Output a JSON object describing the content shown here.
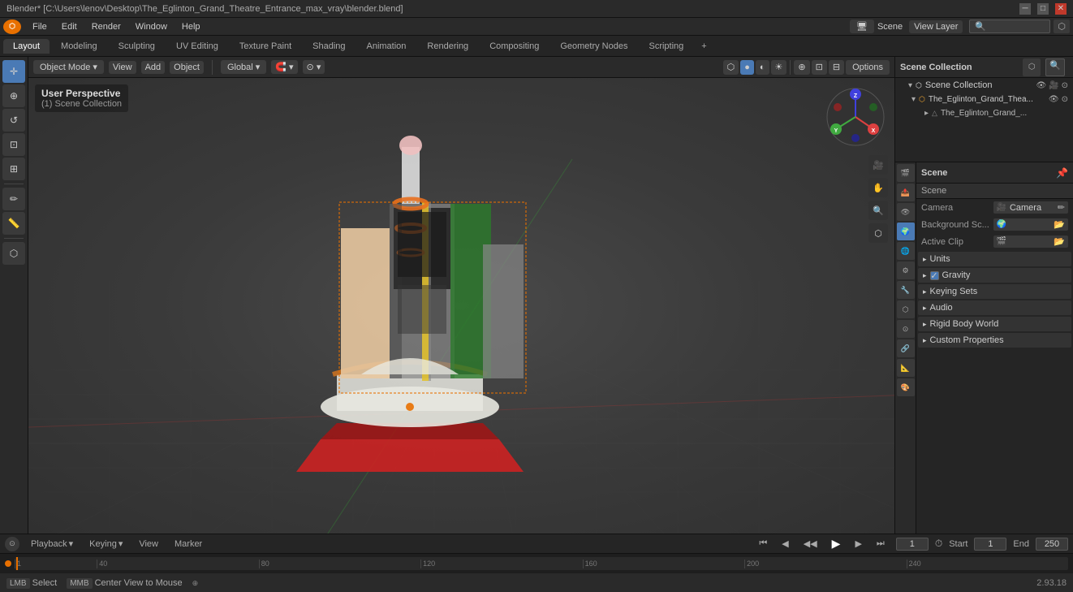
{
  "window": {
    "title": "Blender* [C:\\Users\\lenov\\Desktop\\The_Eglinton_Grand_Theatre_Entrance_max_vray\\blender.blend]",
    "controls": [
      "_",
      "□",
      "✕"
    ]
  },
  "menubar": {
    "items": [
      "Blender",
      "File",
      "Edit",
      "Render",
      "Window",
      "Help"
    ]
  },
  "workspace_tabs": {
    "tabs": [
      "Layout",
      "Modeling",
      "Sculpting",
      "UV Editing",
      "Texture Paint",
      "Shading",
      "Animation",
      "Rendering",
      "Compositing",
      "Geometry Nodes",
      "Scripting"
    ],
    "active": "Layout",
    "add_label": "+"
  },
  "viewport": {
    "mode": "Object Mode",
    "view_label": "View",
    "add_label": "Add",
    "object_label": "Object",
    "transform": "Global",
    "view_info": "User Perspective",
    "scene_collection": "(1) Scene Collection",
    "options_label": "Options"
  },
  "nav_gizmo": {
    "x_pos": "X",
    "y_pos": "Y",
    "z_pos": "Z",
    "x_neg": "-X",
    "y_neg": "-Y",
    "z_neg": "-Z"
  },
  "outliner": {
    "title": "Scene Collection",
    "items": [
      {
        "name": "The_Eglinton_Grand_Thea...",
        "type": "collection",
        "expanded": true,
        "children": [
          {
            "name": "The_Eglinton_Grand_...",
            "type": "object"
          }
        ]
      }
    ]
  },
  "properties": {
    "title": "Scene",
    "tabs": [
      {
        "icon": "🎬",
        "name": "render"
      },
      {
        "icon": "📤",
        "name": "output"
      },
      {
        "icon": "👁",
        "name": "view-layer"
      },
      {
        "icon": "🌍",
        "name": "scene"
      },
      {
        "icon": "🌐",
        "name": "world"
      },
      {
        "icon": "⚙",
        "name": "object"
      },
      {
        "icon": "✦",
        "name": "modifier"
      },
      {
        "icon": "▣",
        "name": "particles"
      },
      {
        "icon": "🔧",
        "name": "physics"
      },
      {
        "icon": "⬡",
        "name": "constraints"
      },
      {
        "icon": "📐",
        "name": "data"
      },
      {
        "icon": "🎨",
        "name": "material"
      },
      {
        "icon": "🌑",
        "name": "shader"
      }
    ],
    "active_tab": "scene",
    "scene_header": "Scene",
    "camera_label": "Camera",
    "camera_value": "Camera",
    "bg_scene_label": "Background Sc...",
    "active_clip_label": "Active Clip",
    "sections": [
      {
        "name": "Units",
        "label": "Units",
        "expanded": false
      },
      {
        "name": "Gravity",
        "label": "Gravity",
        "expanded": false,
        "has_checkbox": true,
        "checked": true
      },
      {
        "name": "Keying Sets",
        "label": "Keying Sets",
        "expanded": false
      },
      {
        "name": "Audio",
        "label": "Audio",
        "expanded": false
      },
      {
        "name": "Rigid Body World",
        "label": "Rigid Body World",
        "expanded": false
      },
      {
        "name": "Custom Properties",
        "label": "Custom Properties",
        "expanded": false
      }
    ]
  },
  "timeline": {
    "playback_label": "Playback",
    "keying_label": "Keying",
    "view_label": "View",
    "marker_label": "Marker",
    "current_frame": "1",
    "start_label": "Start",
    "start_frame": "1",
    "end_label": "End",
    "end_frame": "250",
    "ruler_marks": [
      "1",
      "40",
      "80",
      "120",
      "160",
      "200",
      "240"
    ],
    "frame_marks": [
      "1",
      "40",
      "80",
      "120",
      "160",
      "200",
      "240"
    ]
  },
  "status_bar": {
    "select_label": "Select",
    "center_view_label": "Center View to Mouse",
    "version": "2.93.18"
  },
  "tools": [
    {
      "icon": "↔",
      "name": "cursor",
      "active": true
    },
    {
      "icon": "↕",
      "name": "move"
    },
    {
      "icon": "↺",
      "name": "rotate"
    },
    {
      "icon": "⊞",
      "name": "scale"
    },
    {
      "icon": "⊕",
      "name": "transform"
    },
    {
      "separator": true
    },
    {
      "icon": "✏",
      "name": "annotate"
    },
    {
      "icon": "◻",
      "name": "measure"
    },
    {
      "separator": true
    },
    {
      "icon": "⊙",
      "name": "add-cube"
    }
  ],
  "colors": {
    "accent_blue": "#4a7ab5",
    "bg_dark": "#1a1a1a",
    "bg_medium": "#2a2a2a",
    "bg_light": "#3a3a3a",
    "axis_x": "#ff4444",
    "axis_y": "#44ff44",
    "axis_z": "#4444ff",
    "gizmo_x": "#e04040",
    "gizmo_y": "#40a040",
    "gizmo_z": "#4040e0",
    "orange": "#e8a030"
  }
}
